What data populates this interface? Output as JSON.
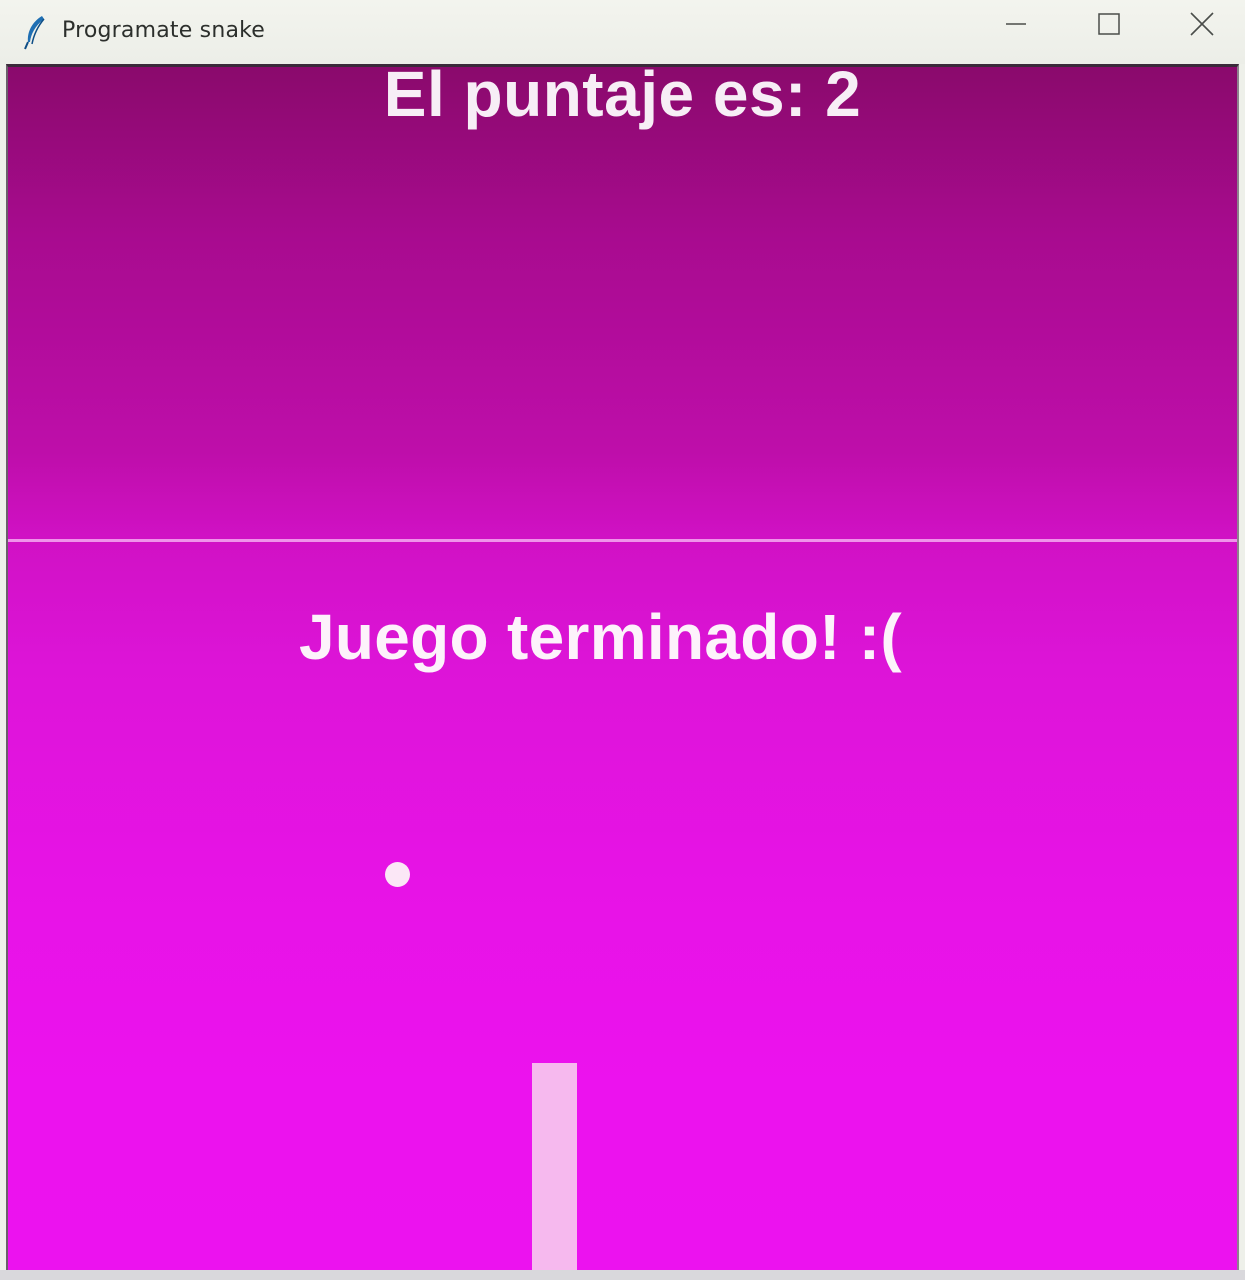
{
  "window": {
    "title": "Programate snake",
    "icon": "feather-icon",
    "controls": {
      "minimize_icon": "minimize-icon",
      "maximize_icon": "maximize-icon",
      "close_icon": "close-icon"
    }
  },
  "game": {
    "score_text": "El puntaje es: 2",
    "game_over_text": "Juego terminado! :(",
    "colors": {
      "background_top": "#8a0a6c",
      "background_bottom": "#ec12ef",
      "text": "#fdf2fb",
      "food": "#fbe7f6",
      "paddle": "#f6b9ee",
      "divider": "#f5aaf0"
    }
  }
}
